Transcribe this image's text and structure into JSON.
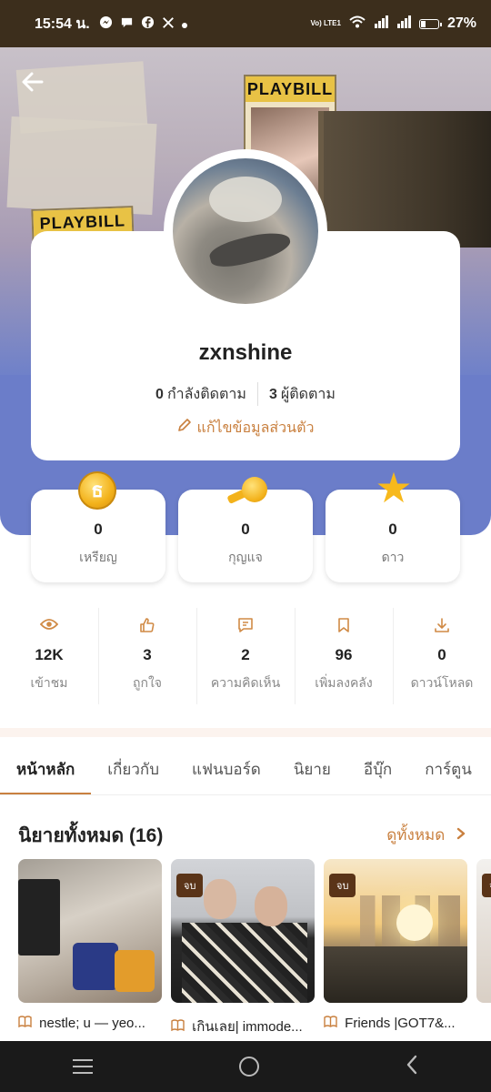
{
  "status_bar": {
    "time": "15:54 น.",
    "notif_icons": [
      "messenger-icon",
      "chat-icon",
      "facebook-icon",
      "x-icon",
      "dot-icon"
    ],
    "volte": "Vo) LTE1",
    "battery_percent": "27%"
  },
  "profile": {
    "username": "zxnshine",
    "following_count": "0",
    "following_label": "กำลังติดตาม",
    "followers_count": "3",
    "followers_label": "ผู้ติดตาม",
    "edit_label": "แก้ไขข้อมูลส่วนตัว"
  },
  "currencies": [
    {
      "icon": "coin-icon",
      "value": "0",
      "label": "เหรียญ"
    },
    {
      "icon": "key-icon",
      "value": "0",
      "label": "กุญแจ"
    },
    {
      "icon": "star-icon",
      "value": "0",
      "label": "ดาว"
    }
  ],
  "stats": [
    {
      "icon": "eye-icon",
      "value": "12K",
      "label": "เข้าชม"
    },
    {
      "icon": "thumbs-up-icon",
      "value": "3",
      "label": "ถูกใจ"
    },
    {
      "icon": "comment-icon",
      "value": "2",
      "label": "ความคิดเห็น"
    },
    {
      "icon": "bookmark-icon",
      "value": "96",
      "label": "เพิ่มลงคลัง"
    },
    {
      "icon": "download-icon",
      "value": "0",
      "label": "ดาวน์โหลด"
    }
  ],
  "tabs": [
    "หน้าหลัก",
    "เกี่ยวกับ",
    "แฟนบอร์ด",
    "นิยาย",
    "อีบุ๊ก",
    "การ์ตูน"
  ],
  "active_tab": "หน้าหลัก",
  "novels_section": {
    "title": "นิยายทั้งหมด (16)",
    "see_all": "ดูทั้งหมด"
  },
  "novels": [
    {
      "title": "nestle; u — yeo...",
      "badge": ""
    },
    {
      "title": "เกินเลย| immode...",
      "badge": "จบ"
    },
    {
      "title": "Friends |GOT7&...",
      "badge": "จบ"
    },
    {
      "title": "",
      "badge": "จ"
    }
  ],
  "colors": {
    "accent": "#c9803f",
    "cover_blue": "#6b7dc9",
    "status_bar": "#3c2e1c",
    "badge_brown": "#5a3418"
  }
}
